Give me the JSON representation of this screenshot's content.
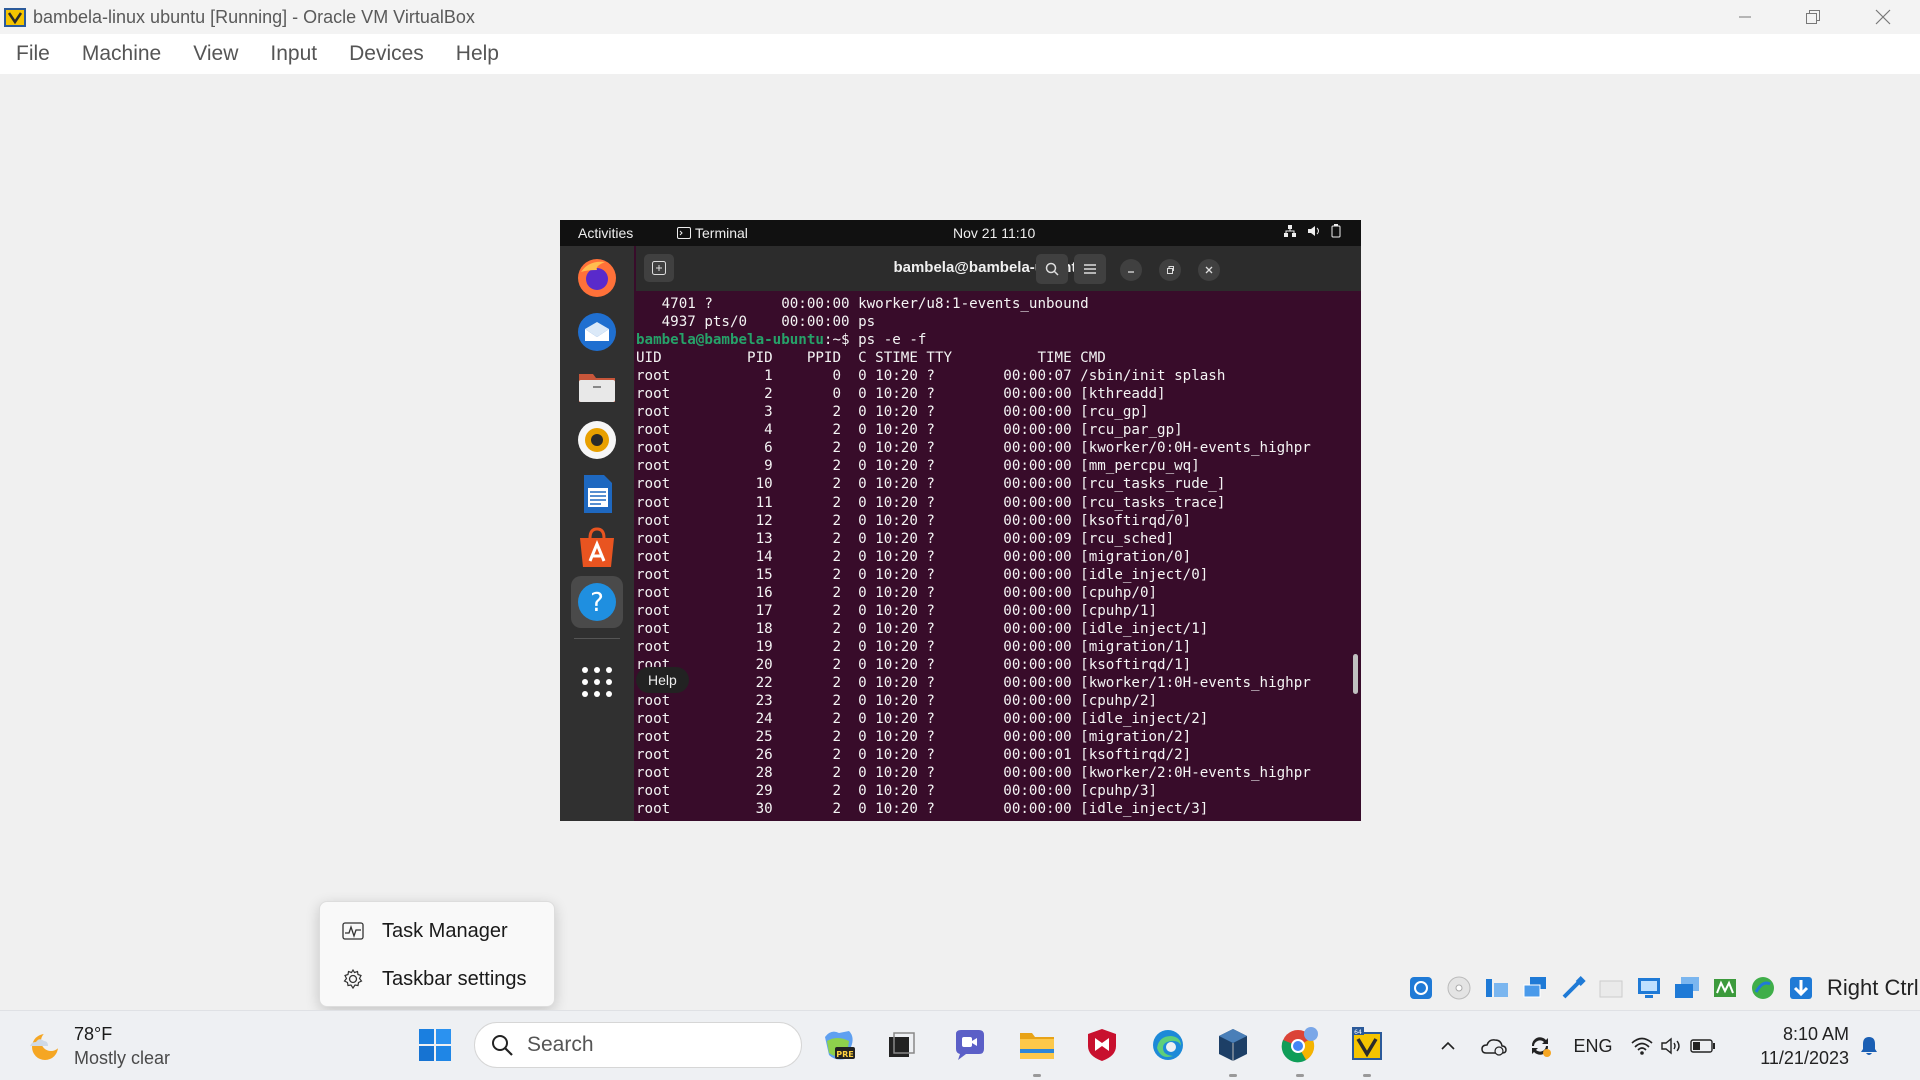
{
  "window": {
    "title": "bambela-linux ubuntu [Running] - Oracle VM VirtualBox"
  },
  "menubar": {
    "items": [
      "File",
      "Machine",
      "View",
      "Input",
      "Devices",
      "Help"
    ]
  },
  "ubuntu": {
    "topbar": {
      "activities": "Activities",
      "app": "Terminal",
      "clock": "Nov 21  11:10"
    },
    "help_tooltip": "Help",
    "terminal": {
      "title": "bambela@bambela-ubuntu: ~",
      "pre_lines": [
        "   4701 ?        00:00:00 kworker/u8:1-events_unbound",
        "   4937 pts/0    00:00:00 ps"
      ],
      "prompt_user": "bambela@bambela-ubuntu",
      "prompt_sep": ":~$ ",
      "command": "ps -e -f",
      "header": "UID          PID    PPID  C STIME TTY          TIME CMD",
      "rows": [
        "root           1       0  0 10:20 ?        00:00:07 /sbin/init splash",
        "root           2       0  0 10:20 ?        00:00:00 [kthreadd]",
        "root           3       2  0 10:20 ?        00:00:00 [rcu_gp]",
        "root           4       2  0 10:20 ?        00:00:00 [rcu_par_gp]",
        "root           6       2  0 10:20 ?        00:00:00 [kworker/0:0H-events_highpr",
        "root           9       2  0 10:20 ?        00:00:00 [mm_percpu_wq]",
        "root          10       2  0 10:20 ?        00:00:00 [rcu_tasks_rude_]",
        "root          11       2  0 10:20 ?        00:00:00 [rcu_tasks_trace]",
        "root          12       2  0 10:20 ?        00:00:00 [ksoftirqd/0]",
        "root          13       2  0 10:20 ?        00:00:09 [rcu_sched]",
        "root          14       2  0 10:20 ?        00:00:00 [migration/0]",
        "root          15       2  0 10:20 ?        00:00:00 [idle_inject/0]",
        "root          16       2  0 10:20 ?        00:00:00 [cpuhp/0]",
        "root          17       2  0 10:20 ?        00:00:00 [cpuhp/1]",
        "root          18       2  0 10:20 ?        00:00:00 [idle_inject/1]",
        "root          19       2  0 10:20 ?        00:00:00 [migration/1]",
        "root          20       2  0 10:20 ?        00:00:00 [ksoftirqd/1]",
        "root          22       2  0 10:20 ?        00:00:00 [kworker/1:0H-events_highpr",
        "root          23       2  0 10:20 ?        00:00:00 [cpuhp/2]",
        "root          24       2  0 10:20 ?        00:00:00 [idle_inject/2]",
        "root          25       2  0 10:20 ?        00:00:00 [migration/2]",
        "root          26       2  0 10:20 ?        00:00:01 [ksoftirqd/2]",
        "root          28       2  0 10:20 ?        00:00:00 [kworker/2:0H-events_highpr",
        "root          29       2  0 10:20 ?        00:00:00 [cpuhp/3]",
        "root          30       2  0 10:20 ?        00:00:00 [idle_inject/3]"
      ]
    }
  },
  "context_menu": {
    "items": [
      "Task Manager",
      "Taskbar settings"
    ]
  },
  "vbox_status": {
    "host_key": "Right Ctrl"
  },
  "taskbar": {
    "weather": {
      "temp": "78°F",
      "condition": "Mostly clear"
    },
    "search_placeholder": "Search",
    "tray": {
      "language": "ENG",
      "time": "8:10 AM",
      "date": "11/21/2023"
    }
  },
  "colors": {
    "terminal_bg": "#380c2a",
    "prompt_green": "#26a269",
    "dock_bg": "#303030"
  }
}
